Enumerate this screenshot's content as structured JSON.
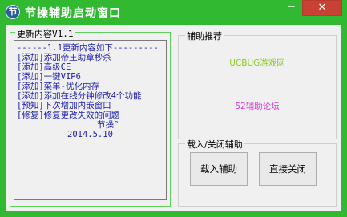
{
  "window": {
    "title": "节操辅助启动窗口",
    "icon_glyph": "节",
    "minimize_glyph": "─",
    "close_glyph": "✕"
  },
  "update_panel": {
    "title": "更新内容V1.1",
    "lines": [
      "------1.1更新内容如下---------",
      "[添加]添加帝王助章秒杀",
      "[添加]高级CE",
      "[添加]一键VIP6",
      "[添加]菜单-优化内存",
      "[添加]添加在线分钟修改4个功能",
      "[预知]下次增加内嵌窗口",
      "[修复]修复更改失效的问题",
      "节操°",
      "2014.5.10"
    ]
  },
  "recommend_panel": {
    "title": "辅助推荐",
    "link1": "UCBUG游戏网",
    "link2": "52辅助论坛"
  },
  "control_panel": {
    "title": "载入/关闭辅助",
    "load_button": "载入辅助",
    "close_button": "直接关闭"
  },
  "colors": {
    "frame": "#31b931",
    "client": "#f0f0f0",
    "list_text": "#2020b0",
    "link1": "#8ccc22",
    "link2": "#d63cd6",
    "close_button": "#c84134"
  }
}
